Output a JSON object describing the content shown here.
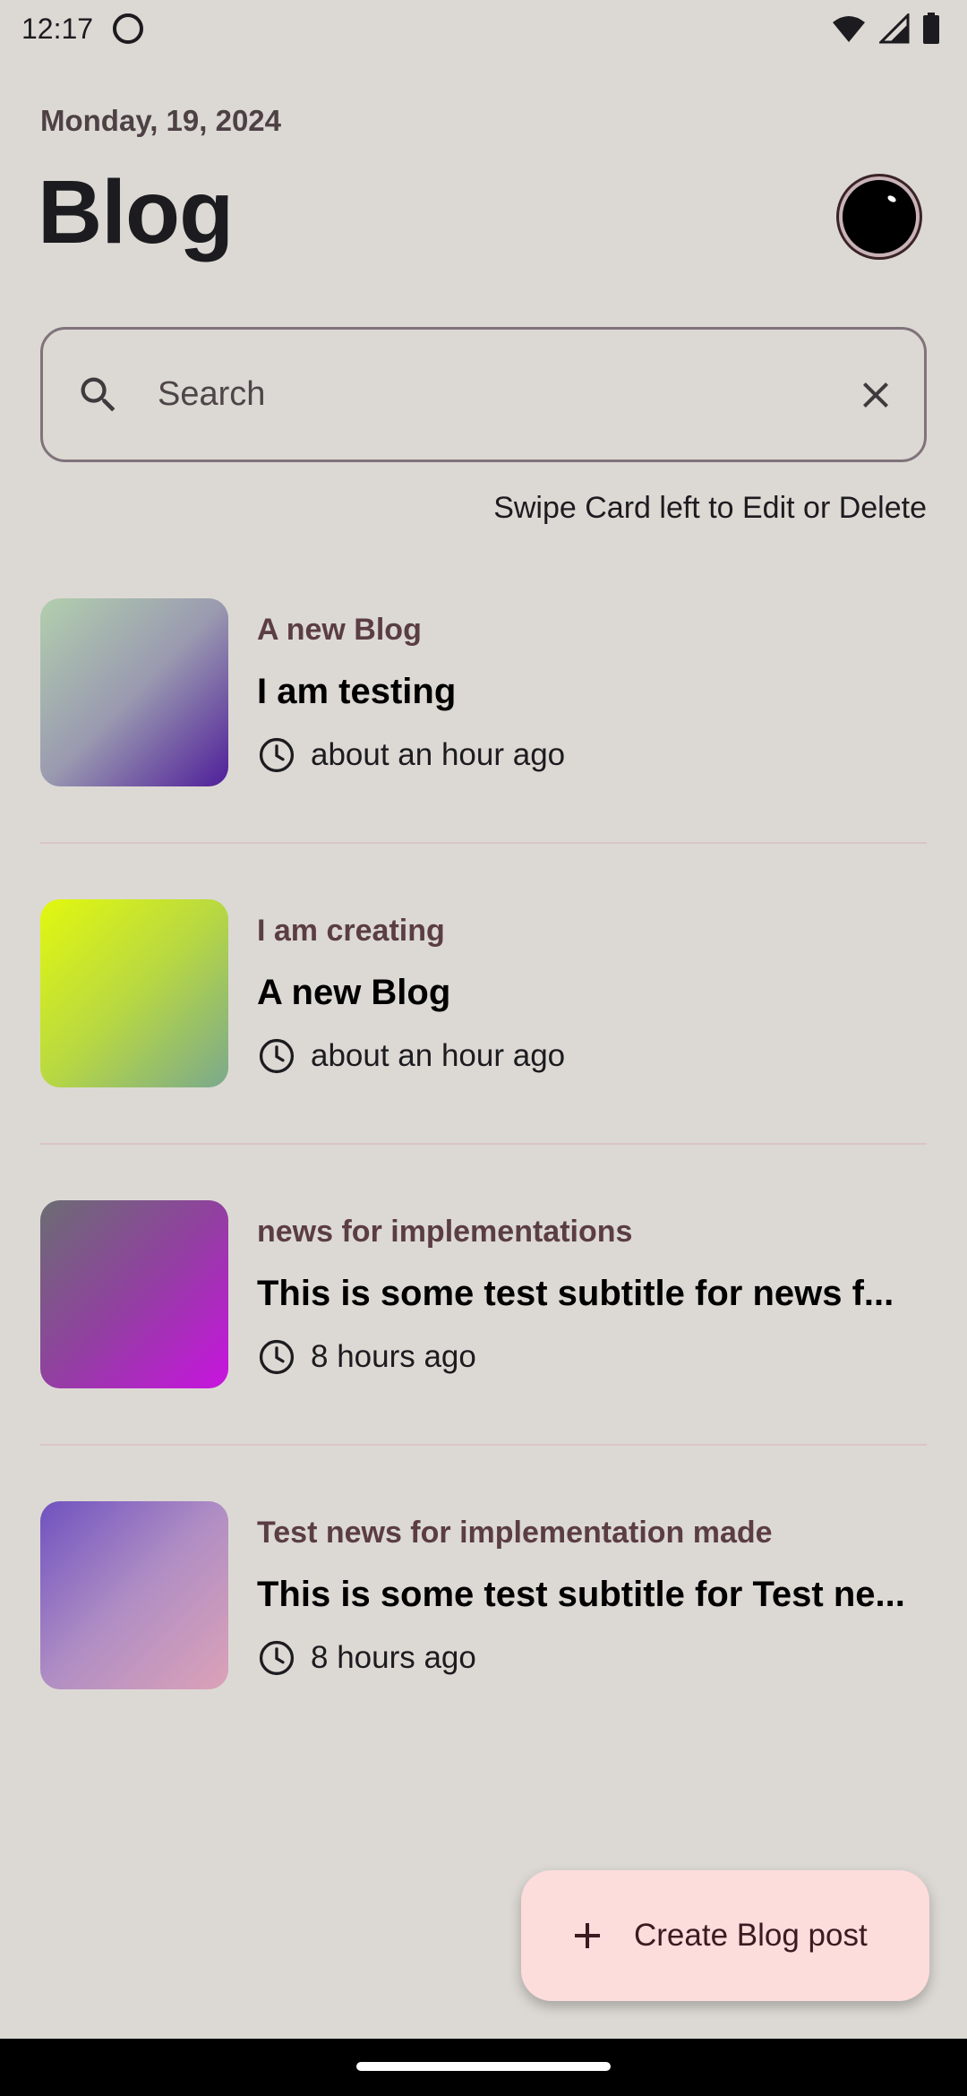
{
  "status_bar": {
    "time": "12:17"
  },
  "header": {
    "date": "Monday, 19, 2024",
    "title": "Blog"
  },
  "search": {
    "placeholder": "Search",
    "value": ""
  },
  "hint": "Swipe Card left to Edit or Delete",
  "posts": [
    {
      "category": "A new Blog",
      "title": "I am testing",
      "time": "about an hour ago",
      "gradient": [
        "#b2cfae",
        "#9a9ab0",
        "#4f1e9a"
      ]
    },
    {
      "category": "I am creating",
      "title": "A new Blog",
      "time": "about an hour ago",
      "gradient": [
        "#e2f80e",
        "#b8d842",
        "#7aa98d"
      ]
    },
    {
      "category": "news for implementations",
      "title": "This is some test subtitle for news f...",
      "time": "8 hours ago",
      "gradient": [
        "#6b6d73",
        "#9140a0",
        "#c913e0"
      ]
    },
    {
      "category": "Test news for implementation made",
      "title": "This is some test subtitle for Test ne...",
      "time": "8 hours ago",
      "gradient": [
        "#6f52c0",
        "#b08ec4",
        "#dca2b8"
      ]
    }
  ],
  "fab": {
    "label": "Create Blog post"
  },
  "colors": {
    "background": "#dcd9d4",
    "fab_background": "#fddcdc",
    "category_text": "#5b3d44"
  }
}
